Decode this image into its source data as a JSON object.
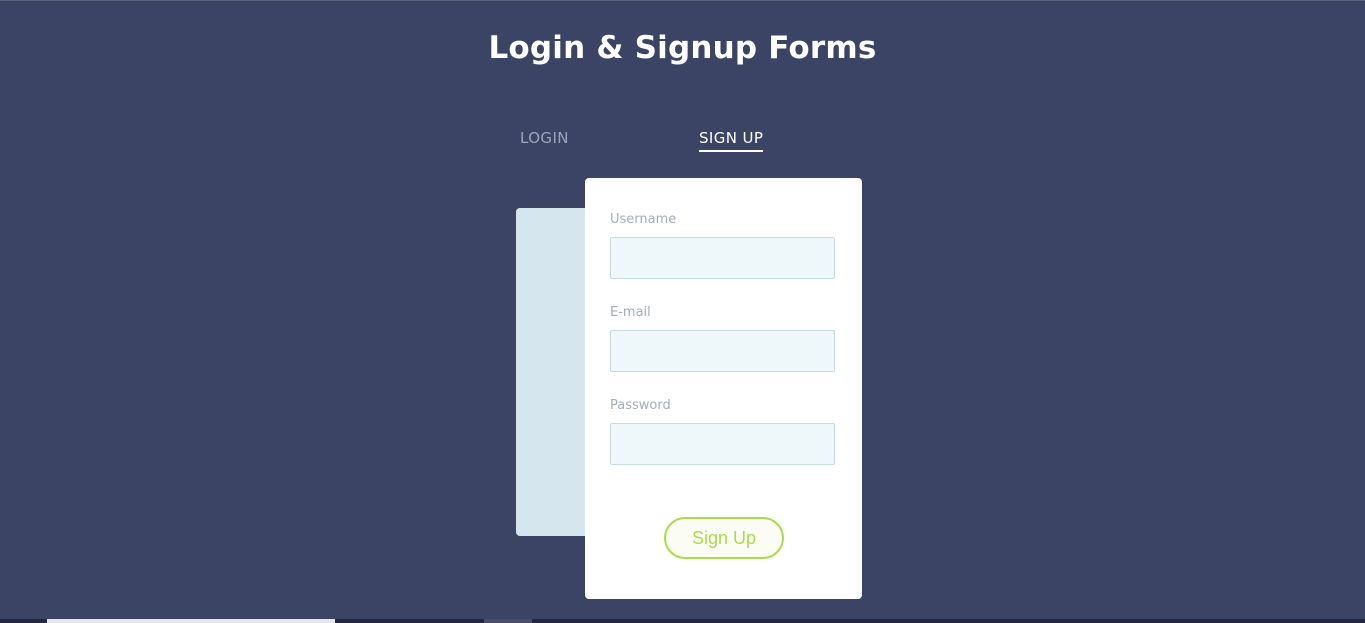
{
  "page": {
    "title": "Login & Signup Forms"
  },
  "tabs": [
    {
      "label": "LOGIN",
      "active": false
    },
    {
      "label": "SIGN UP",
      "active": true
    }
  ],
  "form": {
    "username_label": "Username",
    "username_value": "",
    "email_label": "E-mail",
    "email_value": "",
    "password_label": "Password",
    "password_value": "",
    "submit_label": "Sign Up"
  },
  "colors": {
    "background": "#3c4465",
    "card": "#ffffff",
    "back_card": "#d5e6ef",
    "input_bg": "#eef8fb",
    "accent_green": "#a7dc4b",
    "label_gray": "#a3adb5"
  }
}
